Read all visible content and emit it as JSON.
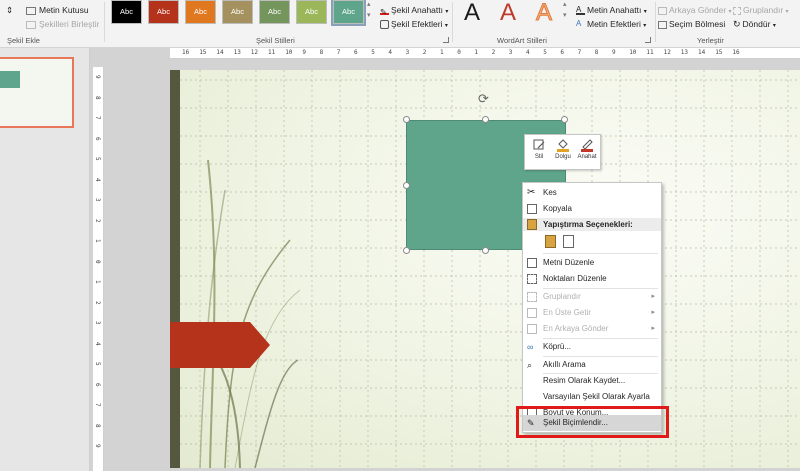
{
  "ribbon": {
    "insert_group": {
      "label": "Şekil Ekle",
      "text_box": "Metin Kutusu",
      "merge_shapes": "Şekilleri Birleştir"
    },
    "shape_styles": {
      "label": "Şekil Stilleri",
      "swatch_text": "Abc",
      "swatches": [
        "#000000",
        "#b5331b",
        "#e0781f",
        "#a4915f",
        "#74965c",
        "#9cb75a",
        "#5ea58b"
      ],
      "fill_outline": "Şekil Anahattı",
      "effects": "Şekil Efektleri"
    },
    "wordart": {
      "label": "WordArt Stilleri",
      "glyph": "A",
      "text_outline": "Metin Anahattı",
      "text_effects": "Metin Efektleri"
    },
    "arrange": {
      "label": "Yerleştir",
      "send_backward": "Arkaya Gönder",
      "selection_pane": "Seçim Bölmesi",
      "group": "Gruplandır",
      "rotate": "Döndür"
    }
  },
  "ruler": {
    "horizontal": [
      "16",
      "15",
      "14",
      "13",
      "12",
      "11",
      "10",
      "9",
      "8",
      "7",
      "6",
      "5",
      "4",
      "3",
      "2",
      "1",
      "0",
      "1",
      "2",
      "3",
      "4",
      "5",
      "6",
      "7",
      "8",
      "9",
      "10",
      "11",
      "12",
      "13",
      "14",
      "15",
      "16"
    ],
    "vertical": [
      "9",
      "8",
      "7",
      "6",
      "5",
      "4",
      "3",
      "2",
      "1",
      "0",
      "1",
      "2",
      "3",
      "4",
      "5",
      "6",
      "7",
      "8",
      "9"
    ]
  },
  "mini_toolbar": {
    "style": "Stil",
    "fill": "Dolgu",
    "outline": "Anahat"
  },
  "context_menu": {
    "cut": "Kes",
    "copy": "Kopyala",
    "paste_options": "Yapıştırma Seçenekleri:",
    "edit_text": "Metni Düzenle",
    "edit_points": "Noktaları Düzenle",
    "group": "Gruplandır",
    "bring_to_front": "En Üste Getir",
    "send_to_back": "En Arkaya Gönder",
    "hyperlink": "Köprü...",
    "smart_lookup": "Akıllı Arama",
    "save_as_picture": "Resim Olarak Kaydet...",
    "set_default": "Varsayılan Şekil Olarak Ayarla",
    "size_position": "Boyut ve Konum...",
    "format_shape": "Şekil Biçimlendir..."
  },
  "colors": {
    "shape_fill": "#5ea58b",
    "arrow_fill": "#b5331b",
    "highlight_box": "#e01919"
  }
}
